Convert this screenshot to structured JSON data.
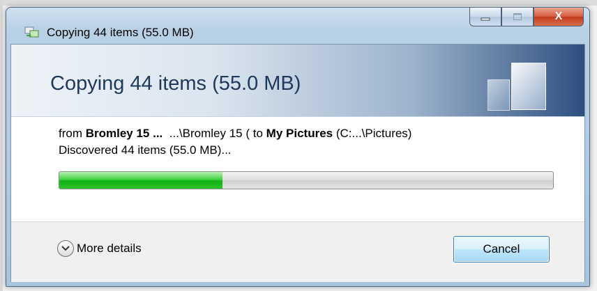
{
  "window": {
    "title": "Copying 44 items (55.0 MB)",
    "close_glyph": "X"
  },
  "banner": {
    "title": "Copying 44 items (55.0 MB)"
  },
  "details": {
    "from_word": "from",
    "source_name": "Bromley 15 ...",
    "source_path": "...\\Bromley 15 (",
    "to_word": "to",
    "dest_name": "My Pictures",
    "dest_path": "(C:...\\Pictures)",
    "status": "Discovered 44 items (55.0 MB)..."
  },
  "progress": {
    "fraction": 0.33,
    "color": "#2ec42e"
  },
  "footer": {
    "more_details_label": "More details",
    "cancel_label": "Cancel"
  },
  "colors": {
    "accent": "#1e395b",
    "close_button": "#c2391b"
  }
}
